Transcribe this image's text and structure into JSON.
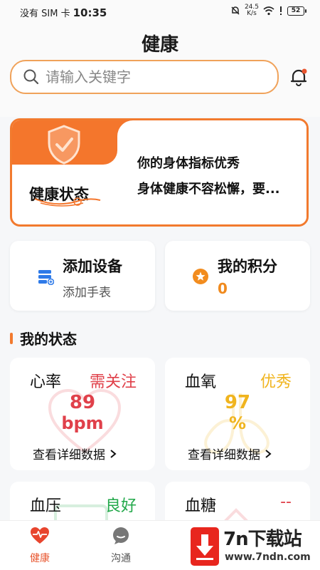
{
  "status_bar": {
    "carrier": "没有 SIM 卡",
    "time": "10:35",
    "speed_value": "24.5",
    "speed_unit": "K/s",
    "battery": "52"
  },
  "header": {
    "title": "健康",
    "search_placeholder": "请输入关键字"
  },
  "health_card": {
    "label": "健康状态",
    "line1": "你的身体指标优秀",
    "line2": "身体健康不容松懈，要..."
  },
  "actions": {
    "devices": {
      "title": "添加设备",
      "subtitle": "添加手表"
    },
    "points": {
      "title": "我的积分",
      "value": "0"
    }
  },
  "section": {
    "title": "我的状态"
  },
  "metrics": {
    "heart_rate": {
      "name": "心率",
      "state": "需关注",
      "value": "89",
      "unit": "bpm",
      "detail": "查看详细数据",
      "color": "#e0404a"
    },
    "blood_oxygen": {
      "name": "血氧",
      "state": "优秀",
      "value": "97",
      "unit": "%",
      "detail": "查看详细数据",
      "color": "#f0b41e"
    },
    "blood_pressure": {
      "name": "血压",
      "state": "良好",
      "color": "#22a84a"
    },
    "blood_sugar": {
      "name": "血糖",
      "state": "--",
      "color": "#e0404a"
    }
  },
  "tabs": [
    {
      "label": "健康",
      "icon": "heart-pulse-icon"
    },
    {
      "label": "沟通",
      "icon": "chat-bubble-icon"
    }
  ],
  "watermark": {
    "title": "7n下载站",
    "url": "www.7ndn.com"
  },
  "colors": {
    "accent": "#f27a2e",
    "search_border": "#f0a25a"
  }
}
